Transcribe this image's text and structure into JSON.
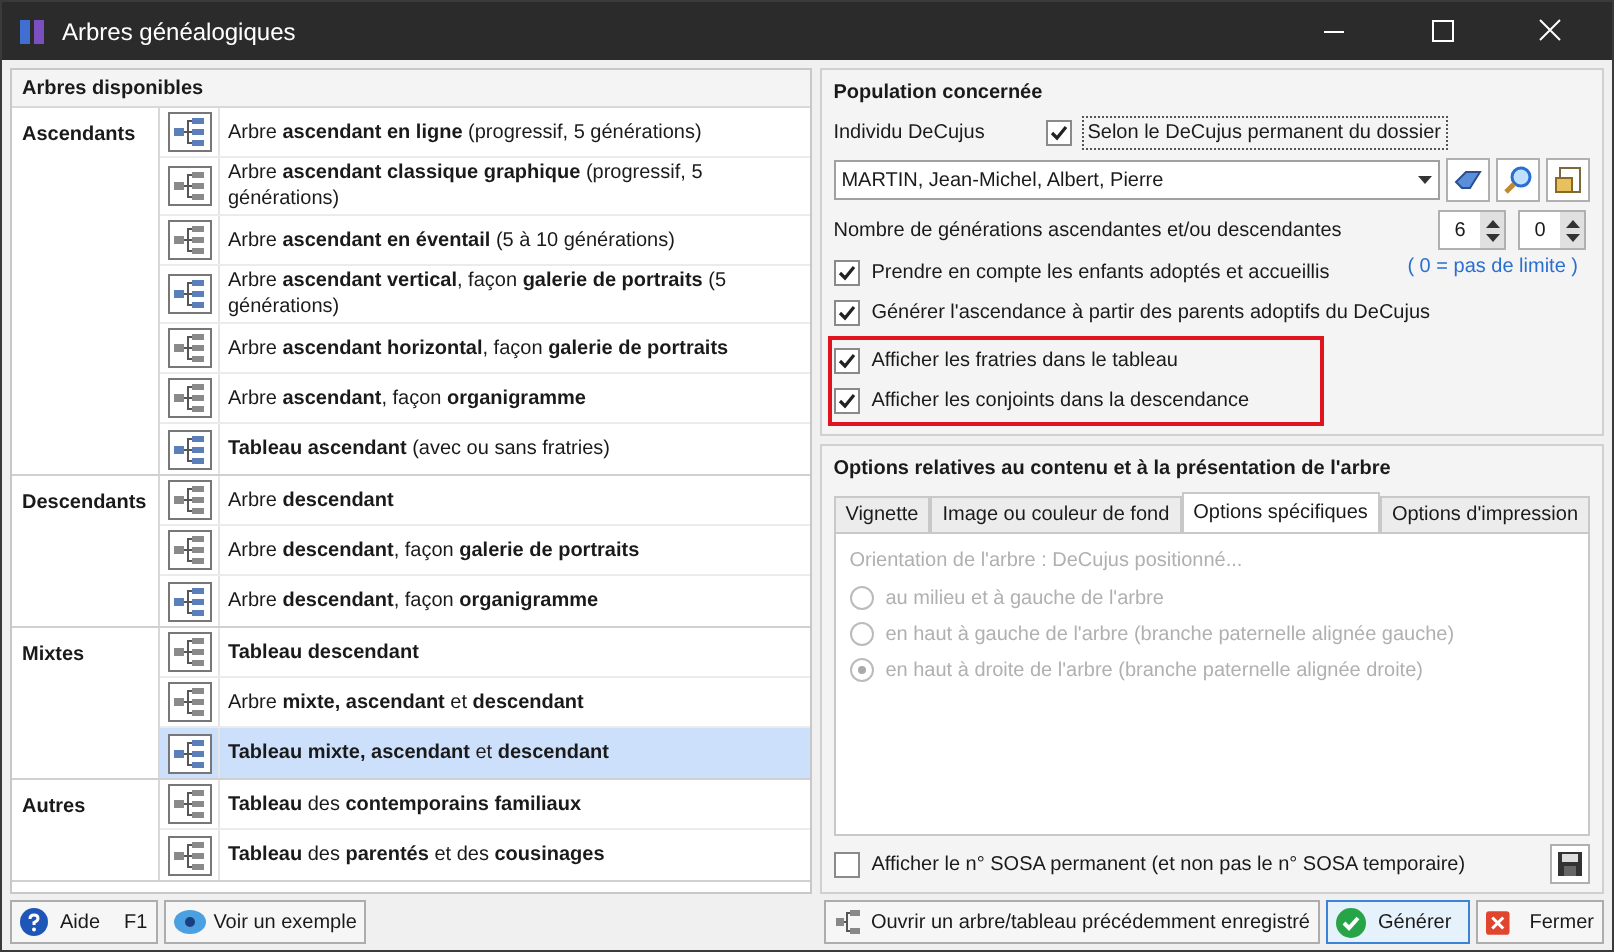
{
  "window": {
    "title": "Arbres généalogiques"
  },
  "left_panel": {
    "title": "Arbres disponibles",
    "groups": [
      {
        "name": "Ascendants",
        "items": [
          {
            "text": "Arbre **ascendant en ligne** (progressif, 5 générations)",
            "selected": false
          },
          {
            "text": "Arbre **ascendant classique graphique** (progressif, 5 générations)",
            "selected": false
          },
          {
            "text": "Arbre **ascendant en éventail** (5 à 10 générations)",
            "selected": false
          },
          {
            "text": "Arbre **ascendant vertical**, façon **galerie de portraits** (5 générations)",
            "selected": false
          },
          {
            "text": "Arbre **ascendant horizontal**, façon **galerie de portraits**",
            "selected": false
          },
          {
            "text": "Arbre **ascendant**, façon **organigramme**",
            "selected": false
          },
          {
            "text": "**Tableau ascendant**  (avec ou sans fratries)",
            "selected": false
          }
        ]
      },
      {
        "name": "Descendants",
        "items": [
          {
            "text": "Arbre **descendant**",
            "selected": false
          },
          {
            "text": "Arbre **descendant**, façon **galerie de portraits**",
            "selected": false
          },
          {
            "text": "Arbre **descendant**, façon **organigramme**",
            "selected": false
          }
        ]
      },
      {
        "name": "Mixtes",
        "items": [
          {
            "text": "**Tableau descendant**",
            "selected": false
          },
          {
            "text": "Arbre **mixte, ascendant** et **descendant**",
            "selected": false
          },
          {
            "text": "**Tableau mixte, ascendant** et **descendant**",
            "selected": true
          }
        ]
      },
      {
        "name": "Autres",
        "items": [
          {
            "text": "**Tableau** des **contemporains familiaux**",
            "selected": false
          },
          {
            "text": "**Tableau** des **parentés** et des **cousinages**",
            "selected": false
          }
        ]
      }
    ]
  },
  "population": {
    "title": "Population concernée",
    "decujus_label": "Individu DeCujus",
    "permanent_checkbox": {
      "label": "Selon le DeCujus permanent du dossier",
      "checked": true
    },
    "person": "MARTIN, Jean-Michel, Albert, Pierre",
    "generations_label": "Nombre de générations ascendantes et/ou descendantes",
    "spin_1": "6",
    "spin_2": "0",
    "limit_note": "( 0 = pas de limite )",
    "options": [
      {
        "label": "Prendre en compte les enfants adoptés et accueillis",
        "checked": true,
        "highlighted": false
      },
      {
        "label": "Générer l'ascendance à partir des parents adoptifs du DeCujus",
        "checked": true,
        "highlighted": false
      },
      {
        "label": "Afficher les fratries dans le tableau",
        "checked": true,
        "highlighted": true
      },
      {
        "label": "Afficher les conjoints dans la descendance",
        "checked": true,
        "highlighted": true
      }
    ]
  },
  "options_section": {
    "title": "Options relatives au contenu et à la présentation de l'arbre",
    "tabs": [
      {
        "label": "Vignette",
        "selected": false
      },
      {
        "label": "Image ou couleur de fond",
        "selected": false
      },
      {
        "label": "Options spécifiques",
        "selected": true
      },
      {
        "label": "Options d'impression",
        "selected": false
      }
    ],
    "orientation_label": "Orientation de l'arbre : DeCujus positionné...",
    "disabled": true,
    "radios": [
      {
        "label": "au milieu et à gauche de l'arbre",
        "selected": false
      },
      {
        "label": "en haut à gauche de l'arbre (branche paternelle alignée gauche)",
        "selected": false
      },
      {
        "label": "en haut à droite de l'arbre (branche paternelle alignée droite)",
        "selected": true
      }
    ],
    "sosa_checkbox": {
      "label": "Afficher le n° SOSA permanent (et non pas le n° SOSA temporaire)",
      "checked": false
    }
  },
  "buttons": {
    "help": "Aide",
    "help_key": "F1",
    "example": "Voir un exemple",
    "open": "Ouvrir un arbre/tableau précédemment enregistré",
    "generate": "Générer",
    "close": "Fermer"
  }
}
